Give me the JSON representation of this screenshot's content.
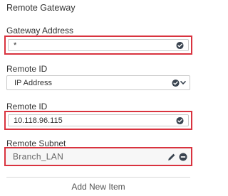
{
  "section": {
    "title": "Remote Gateway"
  },
  "gateway_address": {
    "label": "Gateway Address",
    "value": "*",
    "status_icon": "check-circle-icon"
  },
  "remote_id_type": {
    "label": "Remote ID",
    "selected": "IP Address",
    "status_icon": "check-circle-icon",
    "dropdown_icon": "chevron-down-icon"
  },
  "remote_id_value": {
    "label": "Remote ID",
    "value": "10.118.96.115",
    "status_icon": "check-circle-icon"
  },
  "remote_subnet": {
    "label": "Remote Subnet",
    "items": [
      {
        "value": "Branch_LAN",
        "edit_icon": "pencil-icon",
        "remove_icon": "minus-circle-icon"
      }
    ]
  },
  "add_item": {
    "label": "Add New Item"
  },
  "colors": {
    "highlight": "#d9333f",
    "icon": "#3a4450",
    "border": "#c9c9c9"
  }
}
